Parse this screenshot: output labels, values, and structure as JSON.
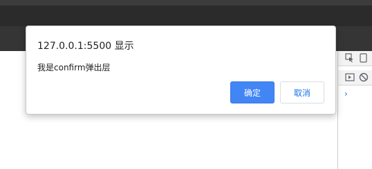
{
  "dialog": {
    "origin": "127.0.0.1:5500 显示",
    "message": "我是confirm弹出层",
    "ok_label": "确定",
    "cancel_label": "取消"
  },
  "devtools": {
    "icons": [
      "inspect-element-icon",
      "device-toggle-icon",
      "sidebar-toggle-icon",
      "block-icon",
      "expand-chevron-icon"
    ],
    "chevron": "›"
  },
  "colors": {
    "primary_button": "#4285f4",
    "cancel_text": "#1a73e8",
    "browser_chrome": "#2b2b2b"
  }
}
